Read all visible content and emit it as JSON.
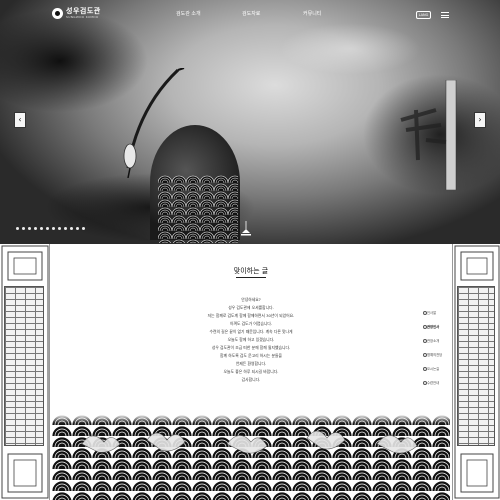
{
  "header": {
    "logo_name": "성우검도관",
    "logo_sub": "SUNGWOO KUMDO",
    "lang_label": "LANG"
  },
  "nav": {
    "items": [
      "검도관 소개",
      "검도자료",
      "커뮤니티"
    ]
  },
  "hero": {
    "slide_count": 12,
    "prev_arrow": "‹",
    "next_arrow": "›"
  },
  "greeting_section": {
    "title": "맞이하는 글",
    "lines": [
      "안녕하세요?",
      "성우 검도관에 오셔를합니다.",
      "저는 함께로 검도계 함께 함께하면서 30년이 되었어요.",
      "아껴도 검도가 어렵습니다.",
      "수련의 길은 끝이 없기 때문입니다. 계속 다른 맛나게",
      "오늘도 함께 하고 있겠습니다.",
      "성우 검도관이 조금 떠한 분께 함께 될지했습니다.",
      "함께 하도록 검도 운고리 하시는 분들을",
      "언제든 환영합니다.",
      "오늘도 좋은 하루 되시길 바랍니다.",
      "감사합니다."
    ]
  },
  "side_nav": {
    "items": [
      "인사말",
      "관장인사",
      "관장소개",
      "명예의전당",
      "오시는길",
      "수련안내"
    ],
    "active_index": 1
  },
  "colors": {
    "accent": "#000000",
    "background": "#ffffff"
  }
}
